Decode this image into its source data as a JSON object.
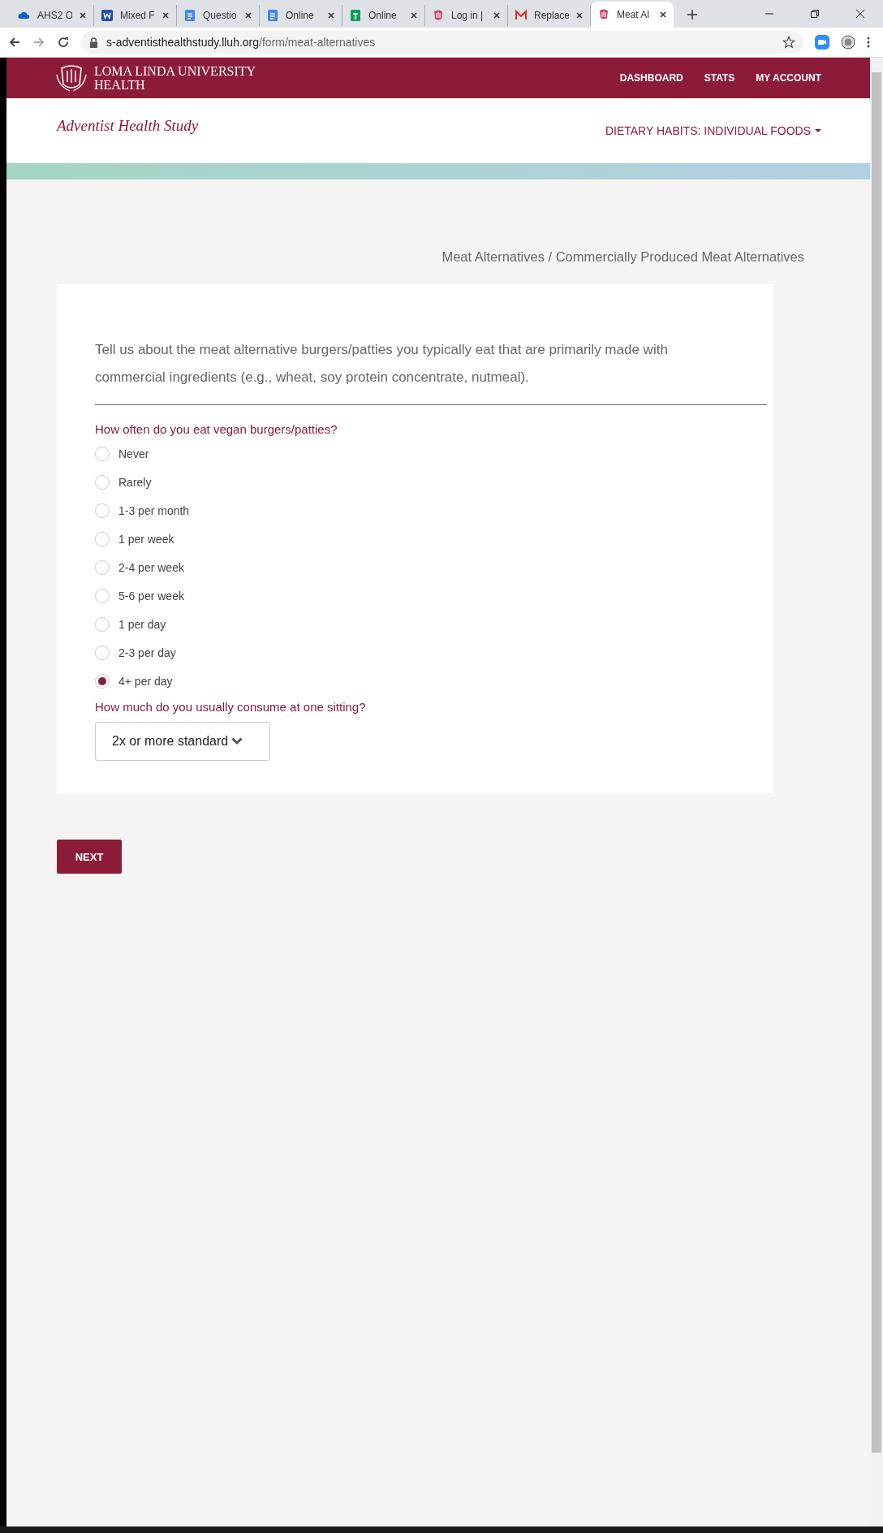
{
  "browser": {
    "tabs": [
      {
        "title": "AHS2 O",
        "kind": "cloud",
        "selected": false
      },
      {
        "title": "Mixed F",
        "kind": "word",
        "selected": false
      },
      {
        "title": "Questio",
        "kind": "doc",
        "selected": false
      },
      {
        "title": "Online",
        "kind": "doc",
        "selected": false
      },
      {
        "title": "Online",
        "kind": "sheet",
        "selected": false
      },
      {
        "title": "Log in |",
        "kind": "crest",
        "selected": false
      },
      {
        "title": "Replace",
        "kind": "mail",
        "selected": false
      },
      {
        "title": "Meat Al",
        "kind": "crest",
        "selected": true
      }
    ],
    "url_host": "s-adventisthealthstudy.lluh.org",
    "url_path": "/form/meat-alternatives"
  },
  "header": {
    "logo_text": "LOMA LINDA UNIVERSITY HEALTH",
    "nav": [
      "DASHBOARD",
      "STATS",
      "MY ACCOUNT"
    ]
  },
  "subheader": {
    "site_title": "Adventist Health Study",
    "section_menu": "DIETARY HABITS: INDIVIDUAL FOODS"
  },
  "breadcrumb": "Meat Alternatives / Commercially Produced Meat Alternatives",
  "form": {
    "intro": "Tell us about the meat alternative burgers/patties you typically eat that are primarily made with commercial ingredients (e.g., wheat, soy protein concentrate, nutmeal).",
    "question_1": "How often do you eat vegan burgers/patties?",
    "options": [
      {
        "label": "Never",
        "selected": false
      },
      {
        "label": "Rarely",
        "selected": false
      },
      {
        "label": "1-3 per month",
        "selected": false
      },
      {
        "label": "1 per week",
        "selected": false
      },
      {
        "label": "2-4 per week",
        "selected": false
      },
      {
        "label": "5-6 per week",
        "selected": false
      },
      {
        "label": "1 per day",
        "selected": false
      },
      {
        "label": "2-3 per day",
        "selected": false
      },
      {
        "label": "4+ per day",
        "selected": true
      }
    ],
    "question_2": "How much do you usually consume at one sitting?",
    "portion": "2x or more standard"
  },
  "next_button": "NEXT"
}
